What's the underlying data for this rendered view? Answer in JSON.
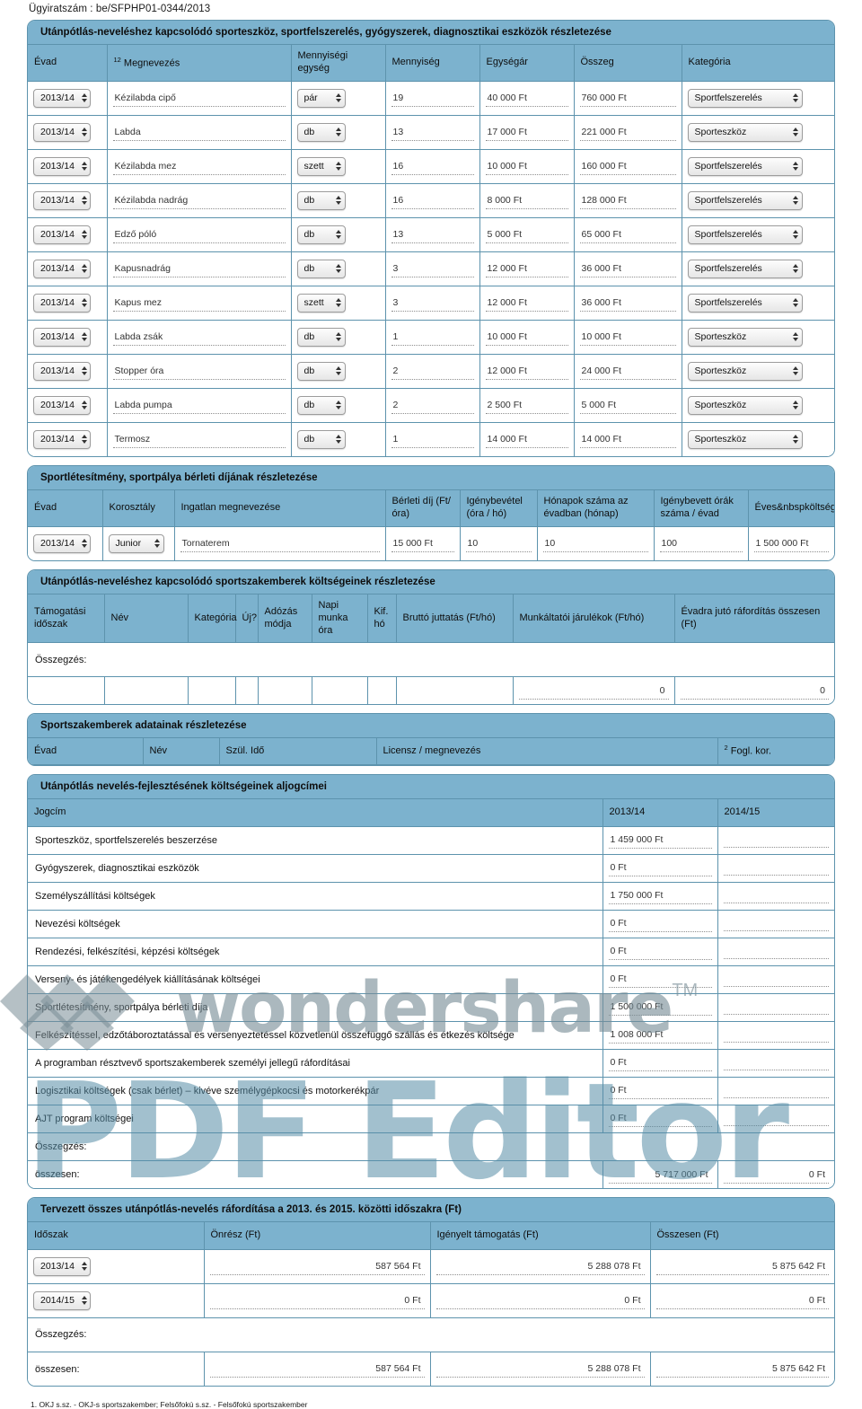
{
  "document": {
    "case_number_label": "Ügyiratszám : be/SFPHP01-0344/2013",
    "footnote": "1. OKJ s.sz. - OKJ-s sportszakember; Felsőfokú s.sz. - Felsőfokú sportszakember",
    "accent_blue": "#7cb2ce",
    "border_blue": "#5d93ad"
  },
  "watermark": {
    "brand": "wondershare",
    "tm": "TM",
    "product": "PDF Editor"
  },
  "equipment_section": {
    "title": "Utánpótlás-neveléshez kapcsolódó sporteszköz, sportfelszerelés, gyógyszerek, diagnosztikai eszközök részletezése",
    "columns": [
      {
        "label": "Évad",
        "sup": ""
      },
      {
        "label": "Megnevezés",
        "sup": "12"
      },
      {
        "label": "Mennyiségi egység",
        "sup": ""
      },
      {
        "label": "Mennyiség",
        "sup": ""
      },
      {
        "label": "Egységár",
        "sup": ""
      },
      {
        "label": "Összeg",
        "sup": ""
      },
      {
        "label": "Kategória",
        "sup": ""
      }
    ],
    "rows": [
      {
        "season": "2013/14",
        "name": "Kézilabda cipő",
        "unit": "pár",
        "qty": "19",
        "unit_price": "40 000 Ft",
        "amount": "760 000 Ft",
        "category": "Sportfelszerelés"
      },
      {
        "season": "2013/14",
        "name": "Labda",
        "unit": "db",
        "qty": "13",
        "unit_price": "17 000 Ft",
        "amount": "221 000 Ft",
        "category": "Sporteszköz"
      },
      {
        "season": "2013/14",
        "name": "Kézilabda mez",
        "unit": "szett",
        "qty": "16",
        "unit_price": "10 000 Ft",
        "amount": "160 000 Ft",
        "category": "Sportfelszerelés"
      },
      {
        "season": "2013/14",
        "name": "Kézilabda nadrág",
        "unit": "db",
        "qty": "16",
        "unit_price": "8 000 Ft",
        "amount": "128 000 Ft",
        "category": "Sportfelszerelés"
      },
      {
        "season": "2013/14",
        "name": "Edző póló",
        "unit": "db",
        "qty": "13",
        "unit_price": "5 000 Ft",
        "amount": "65 000 Ft",
        "category": "Sportfelszerelés"
      },
      {
        "season": "2013/14",
        "name": "Kapusnadrág",
        "unit": "db",
        "qty": "3",
        "unit_price": "12 000 Ft",
        "amount": "36 000 Ft",
        "category": "Sportfelszerelés"
      },
      {
        "season": "2013/14",
        "name": "Kapus mez",
        "unit": "szett",
        "qty": "3",
        "unit_price": "12 000 Ft",
        "amount": "36 000 Ft",
        "category": "Sportfelszerelés"
      },
      {
        "season": "2013/14",
        "name": "Labda zsák",
        "unit": "db",
        "qty": "1",
        "unit_price": "10 000 Ft",
        "amount": "10 000 Ft",
        "category": "Sporteszköz"
      },
      {
        "season": "2013/14",
        "name": "Stopper óra",
        "unit": "db",
        "qty": "2",
        "unit_price": "12 000 Ft",
        "amount": "24 000 Ft",
        "category": "Sporteszköz"
      },
      {
        "season": "2013/14",
        "name": "Labda pumpa",
        "unit": "db",
        "qty": "2",
        "unit_price": "2 500 Ft",
        "amount": "5 000 Ft",
        "category": "Sporteszköz"
      },
      {
        "season": "2013/14",
        "name": "Termosz",
        "unit": "db",
        "qty": "1",
        "unit_price": "14 000 Ft",
        "amount": "14 000 Ft",
        "category": "Sporteszköz"
      }
    ]
  },
  "facility_section": {
    "title": "Sportlétesítmény, sportpálya bérleti díjának részletezése",
    "columns": [
      "Évad",
      "Korosztály",
      "Ingatlan megnevezése",
      "Bérleti díj (Ft/óra)",
      "Igénybevétel (óra / hó)",
      "Hónapok száma az évadban (hónap)",
      "Igénybevett órák száma / évad",
      "Éves&nbspköltség"
    ],
    "rows": [
      {
        "season": "2013/14",
        "age_group": "Junior",
        "property": "Tornaterem",
        "rent": "15 000 Ft",
        "usage": "10",
        "months": "10",
        "hours_per_season": "100",
        "annual_cost": "1 500 000 Ft"
      }
    ]
  },
  "staff_cost_section": {
    "title": "Utánpótlás-neveléshez kapcsolódó sportszakemberek költségeinek részletezése",
    "columns": [
      "Támogatási időszak",
      "Név",
      "Kategória",
      "Új?",
      "Adózás módja",
      "Napi munka óra",
      "Kif. hó",
      "Bruttó juttatás (Ft/hó)",
      "Munkáltatói járulékok (Ft/hó)",
      "Évadra jutó ráfordítás összesen (Ft)"
    ],
    "summary_label": "Összegzés:",
    "totals": {
      "employer_contributions": "0",
      "season_total": "0"
    }
  },
  "staff_data_section": {
    "title": "Sportszakemberek adatainak részletezése",
    "columns": [
      {
        "label": "Évad",
        "sup": ""
      },
      {
        "label": "Név",
        "sup": ""
      },
      {
        "label": "Szül. Idő",
        "sup": ""
      },
      {
        "label": "Licensz / megnevezés",
        "sup": ""
      },
      {
        "label": "Fogl. kor.",
        "sup": "2"
      }
    ]
  },
  "subtitles_section": {
    "title": "Utánpótlás nevelés-fejlesztésének költségeinek aljogcímei",
    "columns": [
      "Jogcím",
      "2013/14",
      "2014/15"
    ],
    "rows": [
      {
        "title": "Sporteszköz, sportfelszerelés beszerzése",
        "y1": "1 459 000 Ft",
        "y2": ""
      },
      {
        "title": "Gyógyszerek, diagnosztikai eszközök",
        "y1": "0 Ft",
        "y2": ""
      },
      {
        "title": "Személyszállítási költségek",
        "y1": "1 750 000 Ft",
        "y2": ""
      },
      {
        "title": "Nevezési költségek",
        "y1": "0 Ft",
        "y2": ""
      },
      {
        "title": "Rendezési, felkészítési, képzési költségek",
        "y1": "0 Ft",
        "y2": ""
      },
      {
        "title": "Verseny- és játékengedélyek kiállításának költségei",
        "y1": "0 Ft",
        "y2": ""
      },
      {
        "title": "Sportlétesítmény, sportpálya bérleti díja",
        "y1": "1 500 000 Ft",
        "y2": ""
      },
      {
        "title": "Felkészítéssel, edzőtáboroztatással és versenyeztetéssel közvetlenül összefüggő szállás és étkezés költsége",
        "y1": "1 008 000 Ft",
        "y2": ""
      },
      {
        "title": "A programban résztvevő sportszakemberek személyi jellegű ráfordításai",
        "y1": "0 Ft",
        "y2": ""
      },
      {
        "title": "Logisztikai költségek (csak bérlet) – kivéve személygépkocsi és motorkerékpár",
        "y1": "0 Ft",
        "y2": ""
      },
      {
        "title": "AJT program költségei",
        "y1": "0 Ft",
        "y2": ""
      }
    ],
    "summary_label": "Összegzés:",
    "total_label": "összesen:",
    "totals": {
      "y1": "5 717 000 Ft",
      "y2": "0 Ft"
    }
  },
  "planned_total_section": {
    "title": "Tervezett összes utánpótlás-nevelés ráfordítása a 2013. és 2015. közötti időszakra (Ft)",
    "columns": [
      "Időszak",
      "Önrész (Ft)",
      "Igényelt támogatás (Ft)",
      "Összesen (Ft)"
    ],
    "rows": [
      {
        "period": "2013/14",
        "own_share": "587 564 Ft",
        "requested": "5 288 078 Ft",
        "total": "5 875 642 Ft"
      },
      {
        "period": "2014/15",
        "own_share": "0 Ft",
        "requested": "0 Ft",
        "total": "0 Ft"
      }
    ],
    "summary_label": "Összegzés:",
    "total_label": "összesen:",
    "totals": {
      "own_share": "587 564 Ft",
      "requested": "5 288 078 Ft",
      "total": "5 875 642 Ft"
    }
  }
}
